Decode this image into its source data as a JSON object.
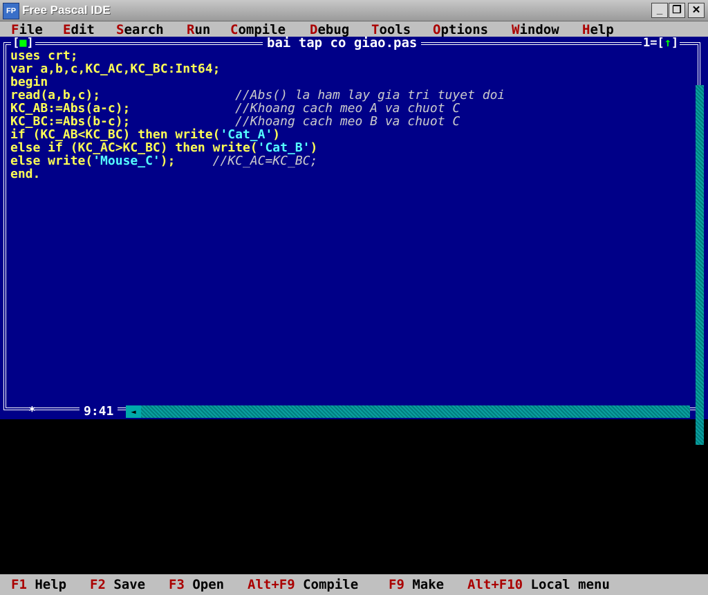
{
  "window": {
    "title": "Free Pascal IDE",
    "icon_text": "FP",
    "buttons": [
      "_",
      "❐",
      "✕"
    ]
  },
  "menu": {
    "items": [
      {
        "hot": "F",
        "rest": "ile"
      },
      {
        "hot": "E",
        "rest": "dit"
      },
      {
        "hot": "S",
        "rest": "earch"
      },
      {
        "hot": "R",
        "rest": "un"
      },
      {
        "hot": "C",
        "rest": "ompile"
      },
      {
        "hot": "D",
        "rest": "ebug"
      },
      {
        "hot": "T",
        "rest": "ools"
      },
      {
        "hot": "O",
        "rest": "ptions"
      },
      {
        "hot": "W",
        "rest": "indow"
      },
      {
        "hot": "H",
        "rest": "elp"
      }
    ]
  },
  "editor": {
    "close_box_left": "[",
    "close_box_mark": "■",
    "close_box_right": "]",
    "file_title": "bai tap co giao.pas",
    "window_number": "1=[",
    "window_arrow": "↑",
    "window_number_end": "]",
    "modified_mark": "*",
    "cursor_pos": "9:41",
    "code_lines": [
      {
        "code": "uses crt;",
        "comment": ""
      },
      {
        "code": "var a,b,c,KC_AC,KC_BC:Int64;",
        "comment": ""
      },
      {
        "code": "begin",
        "comment": ""
      },
      {
        "code": "read(a,b,c);",
        "pad": "                  ",
        "comment": "//Abs() la ham lay gia tri tuyet doi"
      },
      {
        "code": "KC_AB:=Abs(a-c);",
        "pad": "              ",
        "comment": "//Khoang cach meo A va chuot C"
      },
      {
        "code": "KC_BC:=Abs(b-c);",
        "pad": "              ",
        "comment": "//Khoang cach meo B va chuot C"
      },
      {
        "pre": "if (KC_AB<KC_BC) then write(",
        "str": "'Cat_A'",
        "post": ")"
      },
      {
        "pre": "else if (KC_AC>KC_BC) then write(",
        "str": "'Cat_B'",
        "post": ")"
      },
      {
        "pre": "else write(",
        "str": "'Mouse_C'",
        "post": ");",
        "pad": "     ",
        "comment": "//KC_AC=KC_BC;"
      },
      {
        "code": "end.",
        "comment": ""
      }
    ]
  },
  "statusbar": {
    "items": [
      {
        "key": "F1",
        "label": "Help"
      },
      {
        "key": "F2",
        "label": "Save"
      },
      {
        "key": "F3",
        "label": "Open"
      },
      {
        "key": "Alt+F9",
        "label": "Compile"
      },
      {
        "key": "F9",
        "label": "Make"
      },
      {
        "key": "Alt+F10",
        "label": "Local menu"
      }
    ]
  },
  "colors": {
    "editor_bg": "#000088",
    "code_text": "#ffff55",
    "comment_text": "#cccccc",
    "string_text": "#55ffff",
    "hotkey": "#aa0000",
    "menu_bg": "#c0c0c0"
  }
}
